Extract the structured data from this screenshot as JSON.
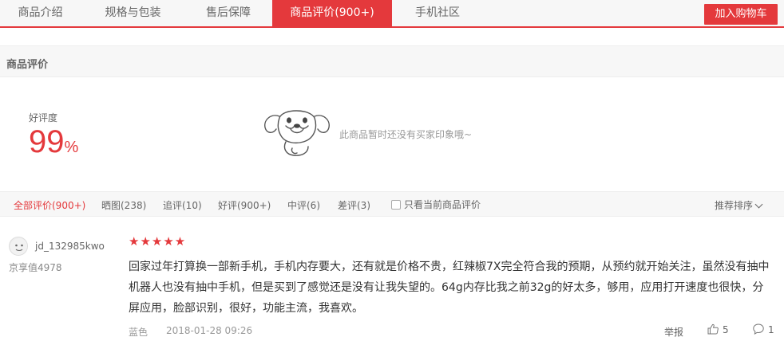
{
  "tabs": [
    {
      "label": "商品介绍"
    },
    {
      "label": "规格与包装"
    },
    {
      "label": "售后保障"
    },
    {
      "label": "商品评价(900+)"
    },
    {
      "label": "手机社区"
    }
  ],
  "cart_button": "加入购物车",
  "section_title": "商品评价",
  "rating": {
    "label": "好评度",
    "value": "99",
    "unit": "%"
  },
  "impression_text": "此商品暂时还没有买家印象哦~",
  "filters": [
    {
      "label": "全部评价(900+)"
    },
    {
      "label": "晒图(238)"
    },
    {
      "label": "追评(10)"
    },
    {
      "label": "好评(900+)"
    },
    {
      "label": "中评(6)"
    },
    {
      "label": "差评(3)"
    }
  ],
  "only_current_label": "只看当前商品评价",
  "sort_label": "推荐排序",
  "review": {
    "username": "jd_132985kwo",
    "user_level": "京享值4978",
    "stars": "★★★★★",
    "star_count": 5,
    "text": "回家过年打算换一部新手机，手机内存要大，还有就是价格不贵，红辣椒7X完全符合我的预期，从预约就开始关注，虽然没有抽中机器人也没有抽中手机，但是买到了感觉还是没有让我失望的。64g内存比我之前32g的好太多，够用，应用打开速度也很快，分屏应用，脸部识别，很好，功能主流，我喜欢。",
    "color": "蓝色",
    "time": "2018-01-28 09:26",
    "report_label": "举报",
    "likes": "5",
    "replies": "1"
  },
  "colors": {
    "accent": "#e4393c"
  }
}
